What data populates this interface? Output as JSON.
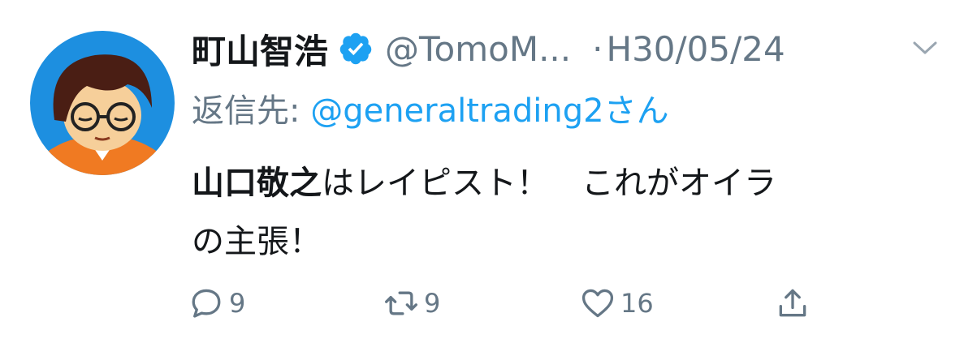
{
  "tweet": {
    "author_name": "町山智浩",
    "handle": "@TomoM...",
    "separator": "·",
    "date": "H30/05/24",
    "reply_label": "返信先:",
    "reply_mention": "@generaltrading2",
    "reply_suffix": "さん",
    "text_bold": "山口敬之",
    "text_line1": "はレイピスト！　これがオイラ",
    "text_line2": "の主張！"
  },
  "actions": {
    "reply_count": "9",
    "retweet_count": "9",
    "like_count": "16"
  },
  "colors": {
    "accent": "#1da1f2",
    "muted": "#657786",
    "text": "#14171a",
    "avatar_bg": "#1d8fe0",
    "avatar_shirt": "#f07a22"
  },
  "icons": [
    "verified-badge-icon",
    "chevron-down-icon",
    "reply-icon",
    "retweet-icon",
    "like-icon",
    "share-icon"
  ]
}
